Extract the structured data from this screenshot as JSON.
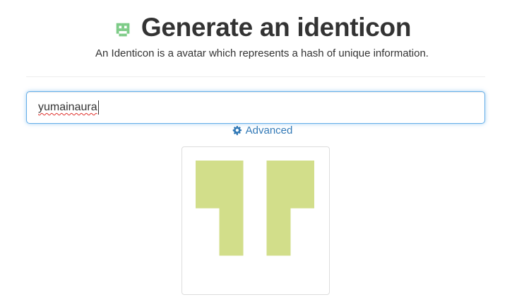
{
  "header": {
    "title": "Generate an identicon",
    "subtitle": "An Identicon is a avatar which represents a hash of unique information.",
    "logo_icon": "identicon-logo-icon",
    "logo_color": "#7dcb87"
  },
  "form": {
    "input_value": "yumainaura",
    "focus_color": "#66afe9",
    "spellcheck_color": "#e0312c"
  },
  "advanced": {
    "label": "Advanced",
    "icon": "gear-icon",
    "color": "#337ab7"
  },
  "identicon": {
    "color": "#d2de8a",
    "grid_size": 5,
    "cells": [
      [
        1,
        1,
        0,
        1,
        1
      ],
      [
        1,
        1,
        0,
        1,
        1
      ],
      [
        0,
        1,
        0,
        1,
        0
      ],
      [
        0,
        1,
        0,
        1,
        0
      ],
      [
        0,
        0,
        0,
        0,
        0
      ]
    ]
  }
}
